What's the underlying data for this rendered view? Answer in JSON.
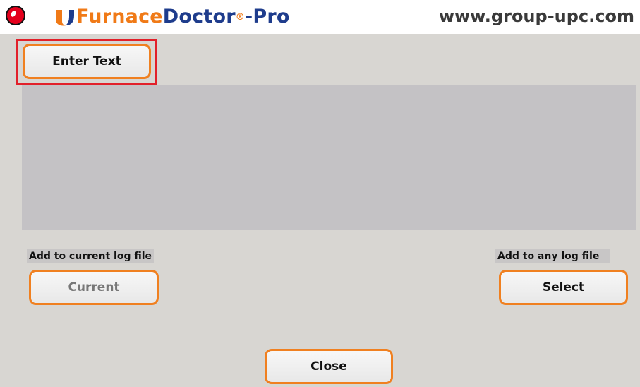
{
  "header": {
    "logo_part1": "Furnace",
    "logo_part2": "Doctor",
    "logo_reg": "®",
    "logo_part3": "-Pro",
    "url": "www.group-upc.com"
  },
  "enter_text_button": "Enter Text",
  "text_area_value": "",
  "current_section": {
    "label": "Add to current log file",
    "button": "Current"
  },
  "any_section": {
    "label": "Add to any log file",
    "button": "Select"
  },
  "close_button": "Close",
  "colors": {
    "accent_orange": "#f08020",
    "highlight_red": "#e2202a",
    "brand_blue": "#1e3c8c",
    "status_red": "#e4001c"
  }
}
